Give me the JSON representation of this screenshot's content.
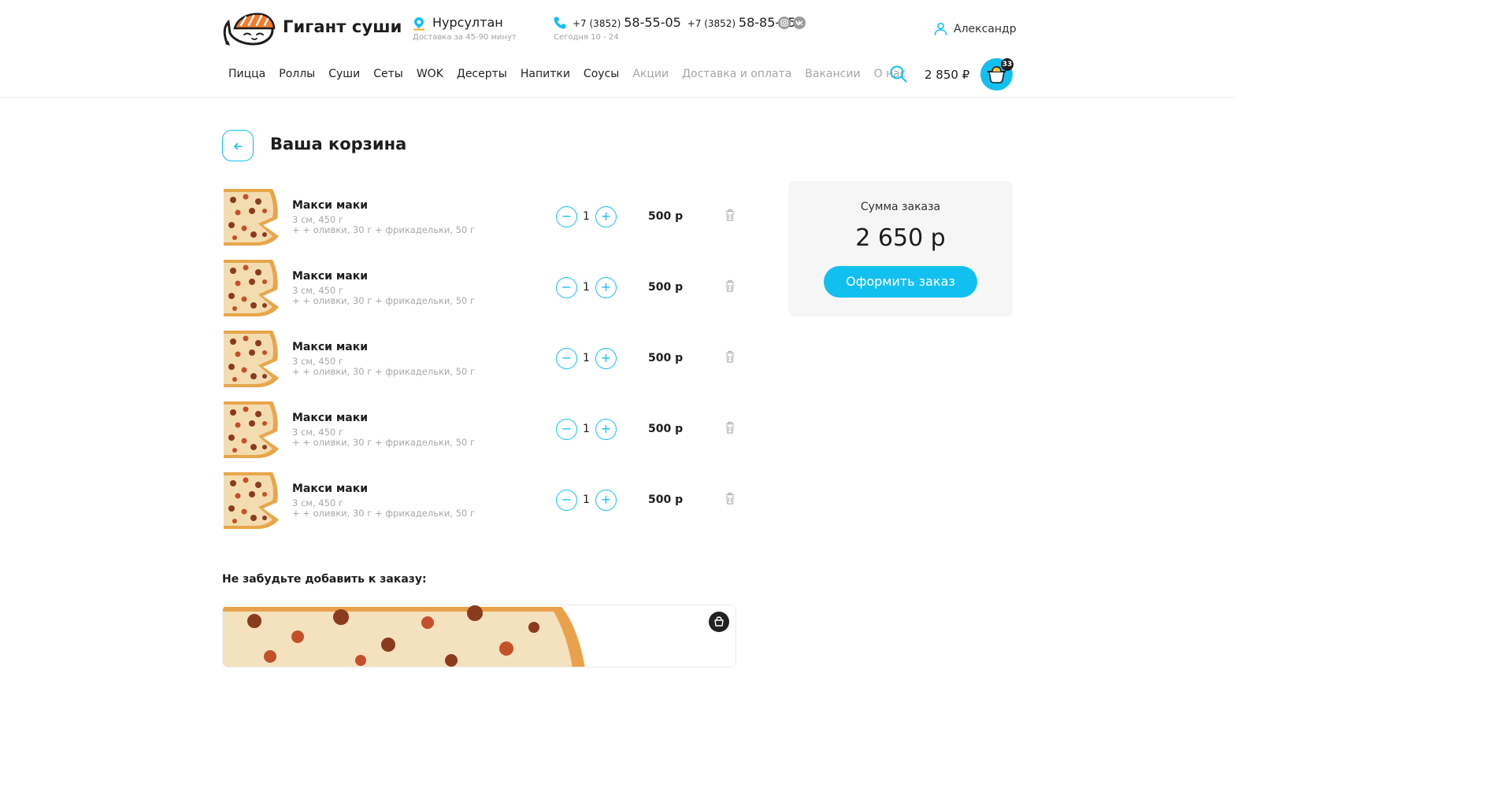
{
  "header": {
    "brand": "Гигант суши",
    "city": "Нурсултан",
    "delivery_note": "Доставка за 45-90 минут",
    "phone_prefix_1": "+7 (3852)",
    "phone_number_1": "58-55-05",
    "phone_prefix_2": "+7 (3852)",
    "phone_number_2": "58-85-05",
    "hours": "Сегодня 10 - 24",
    "user_name": "Александр",
    "cart_total": "2 850 ₽",
    "cart_count": "33",
    "social": [
      "instagram-icon",
      "vk-icon"
    ]
  },
  "nav": [
    {
      "label": "Пицца",
      "muted": false
    },
    {
      "label": "Роллы",
      "muted": false
    },
    {
      "label": "Суши",
      "muted": false
    },
    {
      "label": "Сеты",
      "muted": false
    },
    {
      "label": "WOK",
      "muted": false
    },
    {
      "label": "Десерты",
      "muted": false
    },
    {
      "label": "Напитки",
      "muted": false
    },
    {
      "label": "Соусы",
      "muted": false
    },
    {
      "label": "Акции",
      "muted": true
    },
    {
      "label": "Доставка и оплата",
      "muted": true
    },
    {
      "label": "Вакансии",
      "muted": true
    },
    {
      "label": "О нас",
      "muted": true
    }
  ],
  "page": {
    "title": "Ваша корзина"
  },
  "cart_items": [
    {
      "name": "Макси маки",
      "meta": "3 см, 450 г",
      "extras": "+ + оливки, 30 г + фрикадельки, 50 г",
      "qty": "1",
      "price": "500 р"
    },
    {
      "name": "Макси маки",
      "meta": "3 см, 450 г",
      "extras": "+ + оливки, 30 г + фрикадельки, 50 г",
      "qty": "1",
      "price": "500 р"
    },
    {
      "name": "Макси маки",
      "meta": "3 см, 450 г",
      "extras": "+ + оливки, 30 г + фрикадельки, 50 г",
      "qty": "1",
      "price": "500 р"
    },
    {
      "name": "Макси маки",
      "meta": "3 см, 450 г",
      "extras": "+ + оливки, 30 г + фрикадельки, 50 г",
      "qty": "1",
      "price": "500 р"
    },
    {
      "name": "Макси маки",
      "meta": "3 см, 450 г",
      "extras": "+ + оливки, 30 г + фрикадельки, 50 г",
      "qty": "1",
      "price": "500 р"
    }
  ],
  "summary": {
    "label": "Сумма заказа",
    "total": "2 650 р",
    "checkout_label": "Оформить заказ"
  },
  "upsell": {
    "title": "Не забудьте добавить к заказу:"
  },
  "colors": {
    "accent": "#12c0f0",
    "text": "#1d1d1d",
    "muted": "#a5a5a5",
    "panel": "#f6f6f6"
  }
}
